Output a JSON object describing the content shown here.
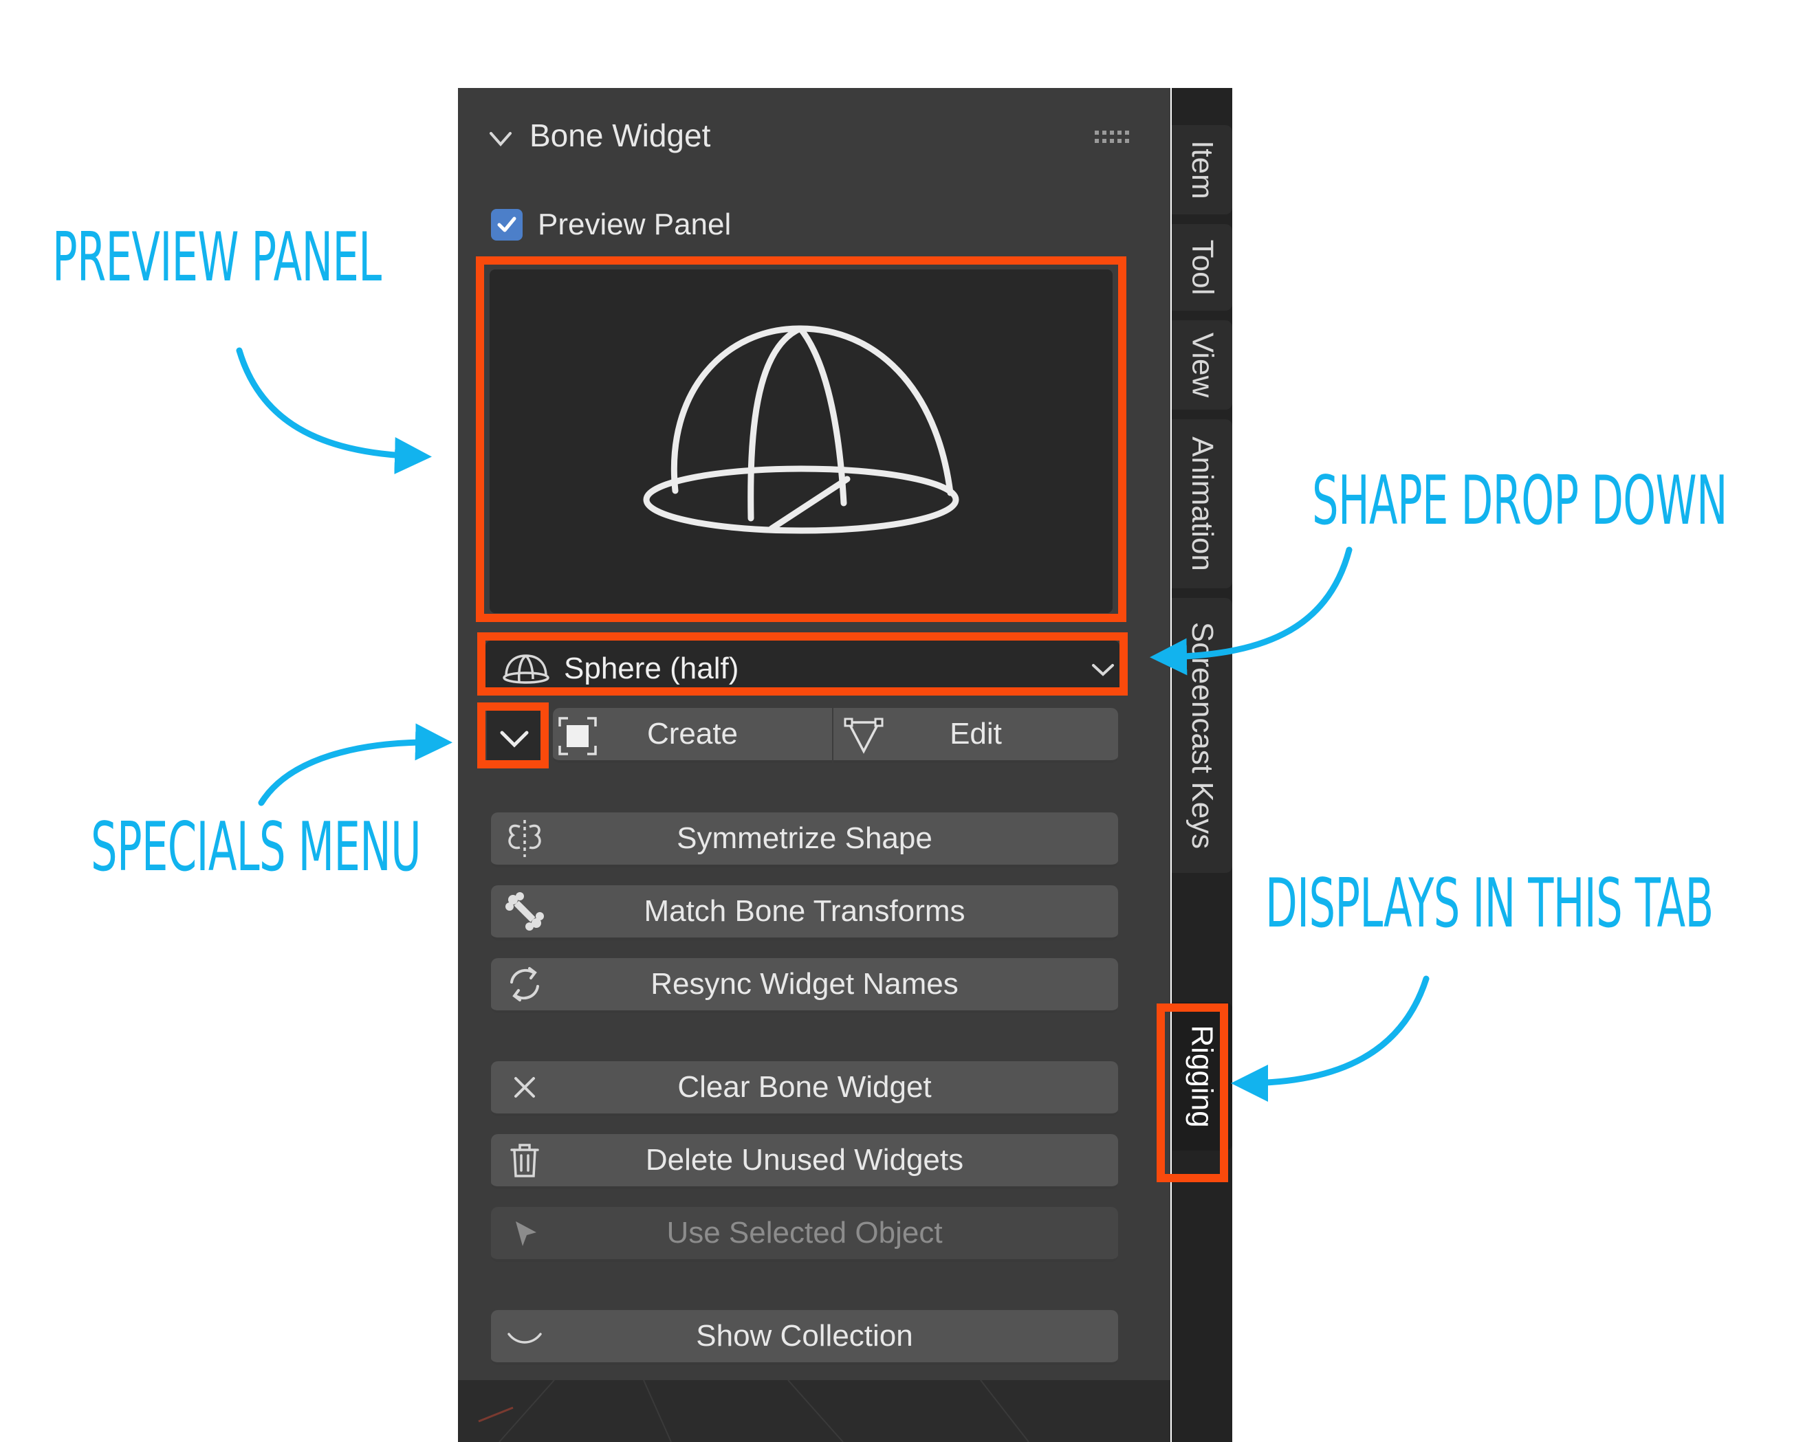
{
  "annotations": {
    "preview_panel": "PREVIEW PANEL",
    "shape_drop_down": "SHAPE DROP DOWN",
    "specials_menu": "SPECIALS MENU",
    "displays_in_this_tab": "DISPLAYS IN THIS TAB"
  },
  "panel": {
    "title": "Bone Widget",
    "preview_checkbox_label": "Preview Panel",
    "preview_checked": true,
    "shape_dropdown_value": "Sphere (half)",
    "create_label": "Create",
    "edit_label": "Edit",
    "buttons": {
      "symmetrize": "Symmetrize Shape",
      "match": "Match Bone Transforms",
      "resync": "Resync Widget Names",
      "clear": "Clear Bone Widget",
      "delete": "Delete Unused Widgets",
      "use_selected": "Use Selected Object",
      "show_collection": "Show Collection"
    }
  },
  "tabs": {
    "item": "Item",
    "tool": "Tool",
    "view": "View",
    "animation": "Animation",
    "screencast": "Screencast Keys",
    "rigging": "Rigging",
    "active": "Rigging"
  },
  "colors": {
    "annotation": "#12b3ee",
    "highlight": "#fa4a0c",
    "checkbox": "#4c7fc9",
    "panel_bg": "#3c3c3c",
    "button_bg": "#545454"
  }
}
